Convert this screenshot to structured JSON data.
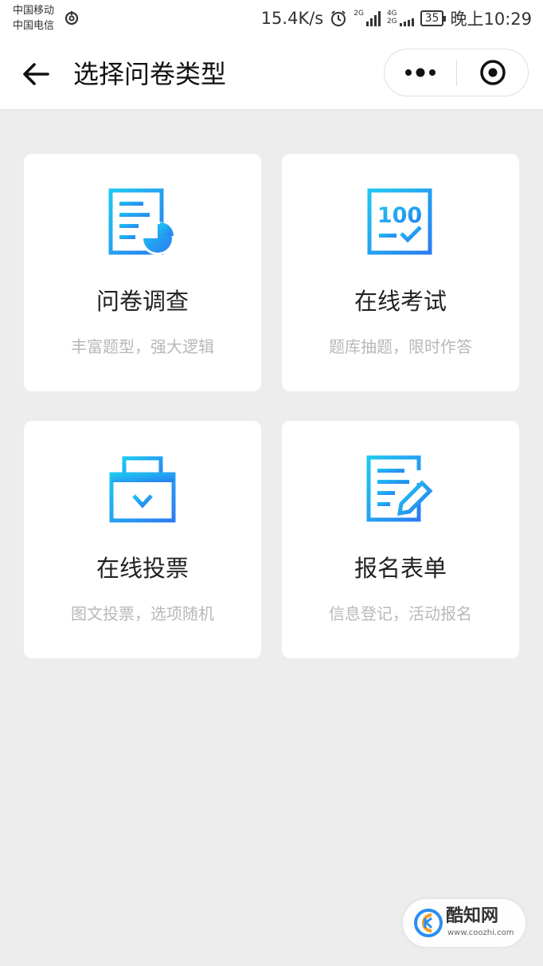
{
  "status_bar": {
    "carrier_1": "中国移动",
    "carrier_2": "中国电信",
    "speed": "15.4K/s",
    "net_1": "2G",
    "net_2": "4G",
    "net_3": "2G",
    "battery": "35",
    "time": "晚上10:29"
  },
  "header": {
    "title": "选择问卷类型"
  },
  "cards": [
    {
      "title": "问卷调查",
      "subtitle": "丰富题型，强大逻辑",
      "icon": "survey-icon"
    },
    {
      "title": "在线考试",
      "subtitle": "题库抽题，限时作答",
      "icon": "exam-icon"
    },
    {
      "title": "在线投票",
      "subtitle": "图文投票，选项随机",
      "icon": "vote-icon"
    },
    {
      "title": "报名表单",
      "subtitle": "信息登记，活动报名",
      "icon": "form-icon"
    }
  ],
  "exam_icon_text": "100",
  "watermark": {
    "name": "酷知网",
    "url": "www.coozhi.com"
  },
  "colors": {
    "accent_start": "#1ec8f0",
    "accent_end": "#2a7cf2",
    "background": "#ededed"
  }
}
